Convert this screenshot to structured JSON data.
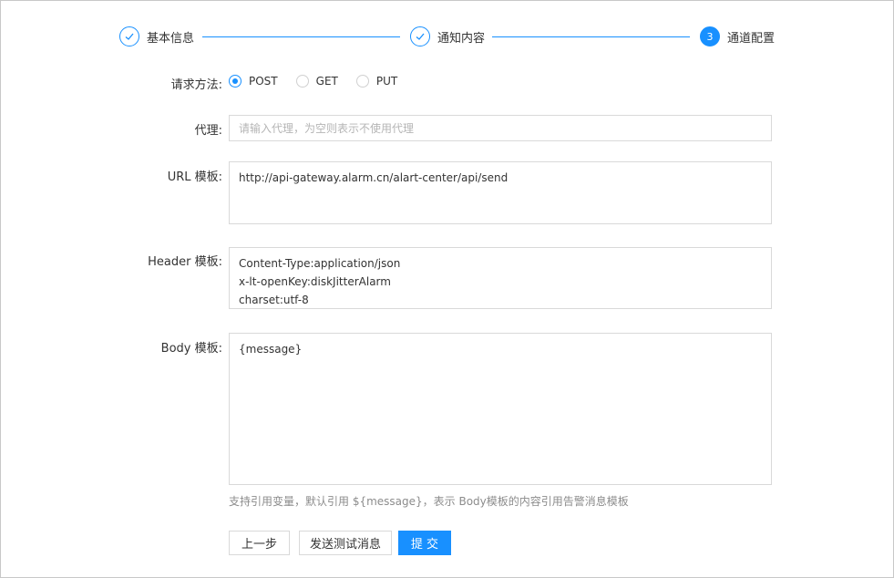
{
  "steps": [
    {
      "title": "基本信息",
      "state": "done",
      "icon": "check-icon"
    },
    {
      "title": "通知内容",
      "state": "done",
      "icon": "check-icon"
    },
    {
      "title": "通道配置",
      "state": "active",
      "number": "3"
    }
  ],
  "form": {
    "method": {
      "label": "请求方法:",
      "options": [
        "POST",
        "GET",
        "PUT"
      ],
      "selected": "POST"
    },
    "proxy": {
      "label": "代理:",
      "value": "",
      "placeholder": "请输入代理，为空则表示不使用代理"
    },
    "url": {
      "label": "URL 模板:",
      "value": "http://api-gateway.alarm.cn/alart-center/api/send"
    },
    "header": {
      "label": "Header 模板:",
      "value": "Content-Type:application/json\nx-lt-openKey:diskJitterAlarm\ncharset:utf-8"
    },
    "body": {
      "label": "Body 模板:",
      "value": "{message}",
      "hint": "支持引用变量，默认引用 ${message}，表示 Body模板的内容引用告警消息模板"
    }
  },
  "buttons": {
    "prev": "上一步",
    "test": "发送测试消息",
    "submit": "提 交"
  },
  "colors": {
    "accent": "#1890ff"
  }
}
